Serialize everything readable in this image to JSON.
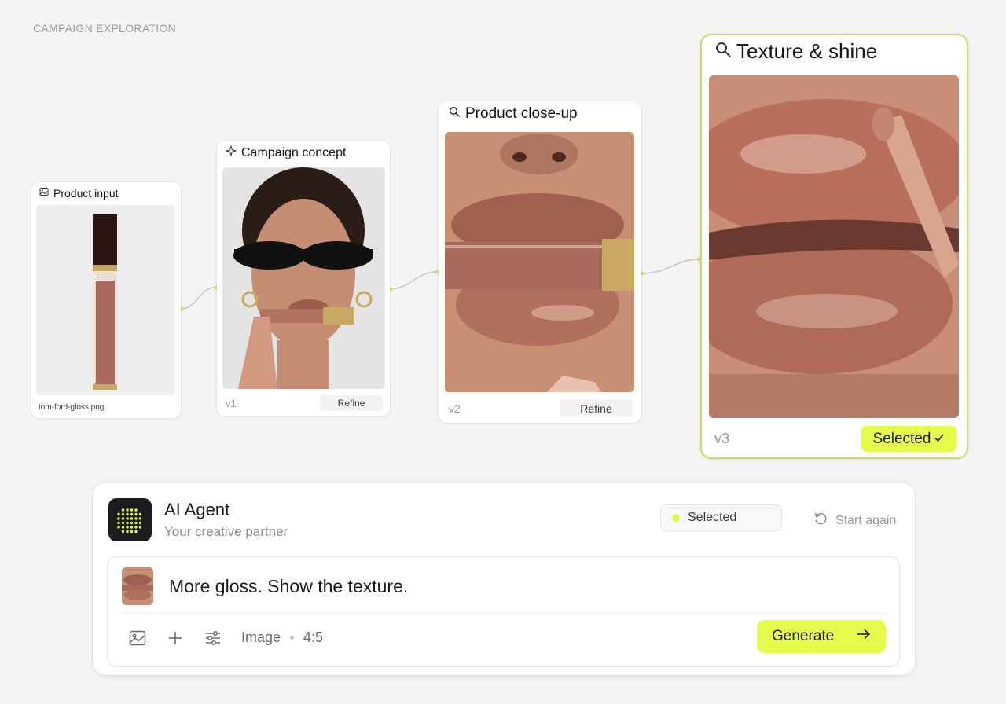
{
  "page": {
    "label": "CAMPAIGN EXPLORATION"
  },
  "nodes": [
    {
      "title": "Product input",
      "icon": "image-icon",
      "filename": "tom-ford-gloss.png"
    },
    {
      "title": "Campaign concept",
      "icon": "sparkle-icon",
      "version": "v1",
      "action": "Refine"
    },
    {
      "title": "Product close-up",
      "icon": "search-icon",
      "version": "v2",
      "action": "Refine"
    },
    {
      "title": "Texture & shine",
      "icon": "search-icon",
      "version": "v3",
      "action": "Selected",
      "selected": true
    }
  ],
  "agent": {
    "name": "AI Agent",
    "subtitle": "Your creative partner",
    "status": "Selected",
    "restart": "Start again",
    "prompt": "More gloss. Show the texture.",
    "mode": "Image",
    "ratio": "4:5",
    "generate": "Generate"
  },
  "colors": {
    "accent": "#e4fb4c",
    "selected_border": "#c7e06a",
    "background": "#f4f4f5",
    "lip": "#b97a62",
    "gloss": "#8c5a4c"
  }
}
